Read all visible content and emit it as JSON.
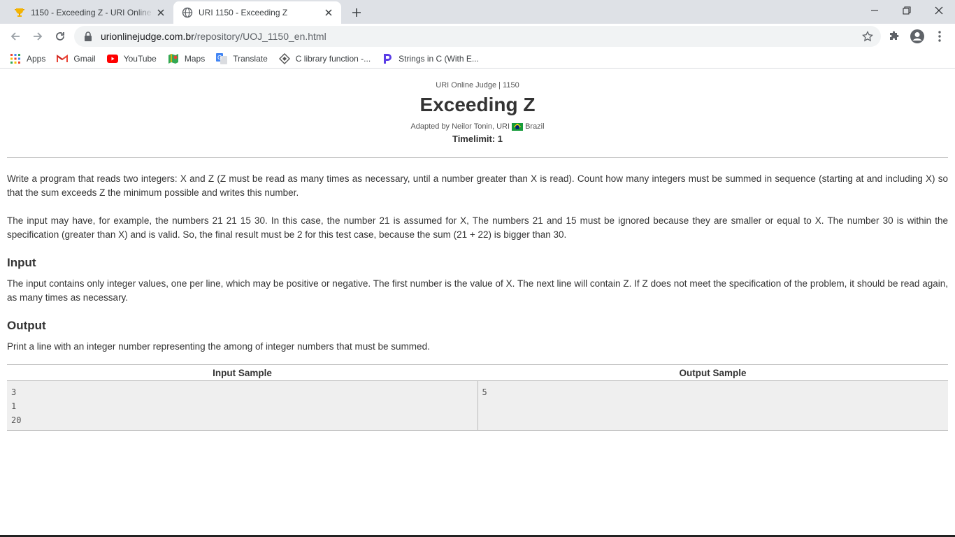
{
  "browser": {
    "tabs": [
      {
        "title": "1150 - Exceeding Z - URI Online Judge",
        "favicon": "trophy-icon",
        "active": false
      },
      {
        "title": "URI 1150 - Exceeding Z",
        "favicon": "globe-icon",
        "active": true
      }
    ],
    "url": {
      "host": "urionlinejudge.com.br",
      "path": "/repository/UOJ_1150_en.html"
    },
    "bookmarks": [
      {
        "label": "Apps",
        "icon": "apps-grid-icon"
      },
      {
        "label": "Gmail",
        "icon": "gmail-icon"
      },
      {
        "label": "YouTube",
        "icon": "youtube-icon"
      },
      {
        "label": "Maps",
        "icon": "maps-icon"
      },
      {
        "label": "Translate",
        "icon": "translate-icon"
      },
      {
        "label": "C library function -...",
        "icon": "diamond-icon"
      },
      {
        "label": "Strings in C (With E...",
        "icon": "programiz-icon"
      }
    ]
  },
  "problem": {
    "subtitle": "URI Online Judge | 1150",
    "title": "Exceeding Z",
    "adapted_prefix": "Adapted by Neilor Tonin, URI",
    "country": "Brazil",
    "timelimit": "Timelimit: 1",
    "paragraph1": "Write a program that reads two integers: X and Z (Z must be read as many times as necessary, until a number greater than X is read). Count how many integers must be summed in sequence (starting at and including X) so that the sum exceeds Z the minimum possible and writes this number.",
    "paragraph2": "The input may have, for example, the numbers 21 21 15 30. In this case, the number 21 is assumed for X, The numbers 21 and 15 must be ignored because they are smaller or equal to X. The number 30 is within the specification (greater than X) and is valid. So, the final result must be 2 for this test case, because the sum (21 + 22) is bigger than 30.",
    "input_heading": "Input",
    "input_text": "The input contains only integer values, one per line, which may be positive or negative. The first number is the value of X. The next line will contain Z. If Z does not meet the specification of the problem, it should be read again, as many times as necessary.",
    "output_heading": "Output",
    "output_text": "Print a line with an integer number representing the among of integer numbers that must be summed.",
    "samples": {
      "input_header": "Input Sample",
      "output_header": "Output Sample",
      "input_lines": [
        "3",
        "1",
        "20"
      ],
      "output_lines": [
        "5"
      ]
    }
  }
}
